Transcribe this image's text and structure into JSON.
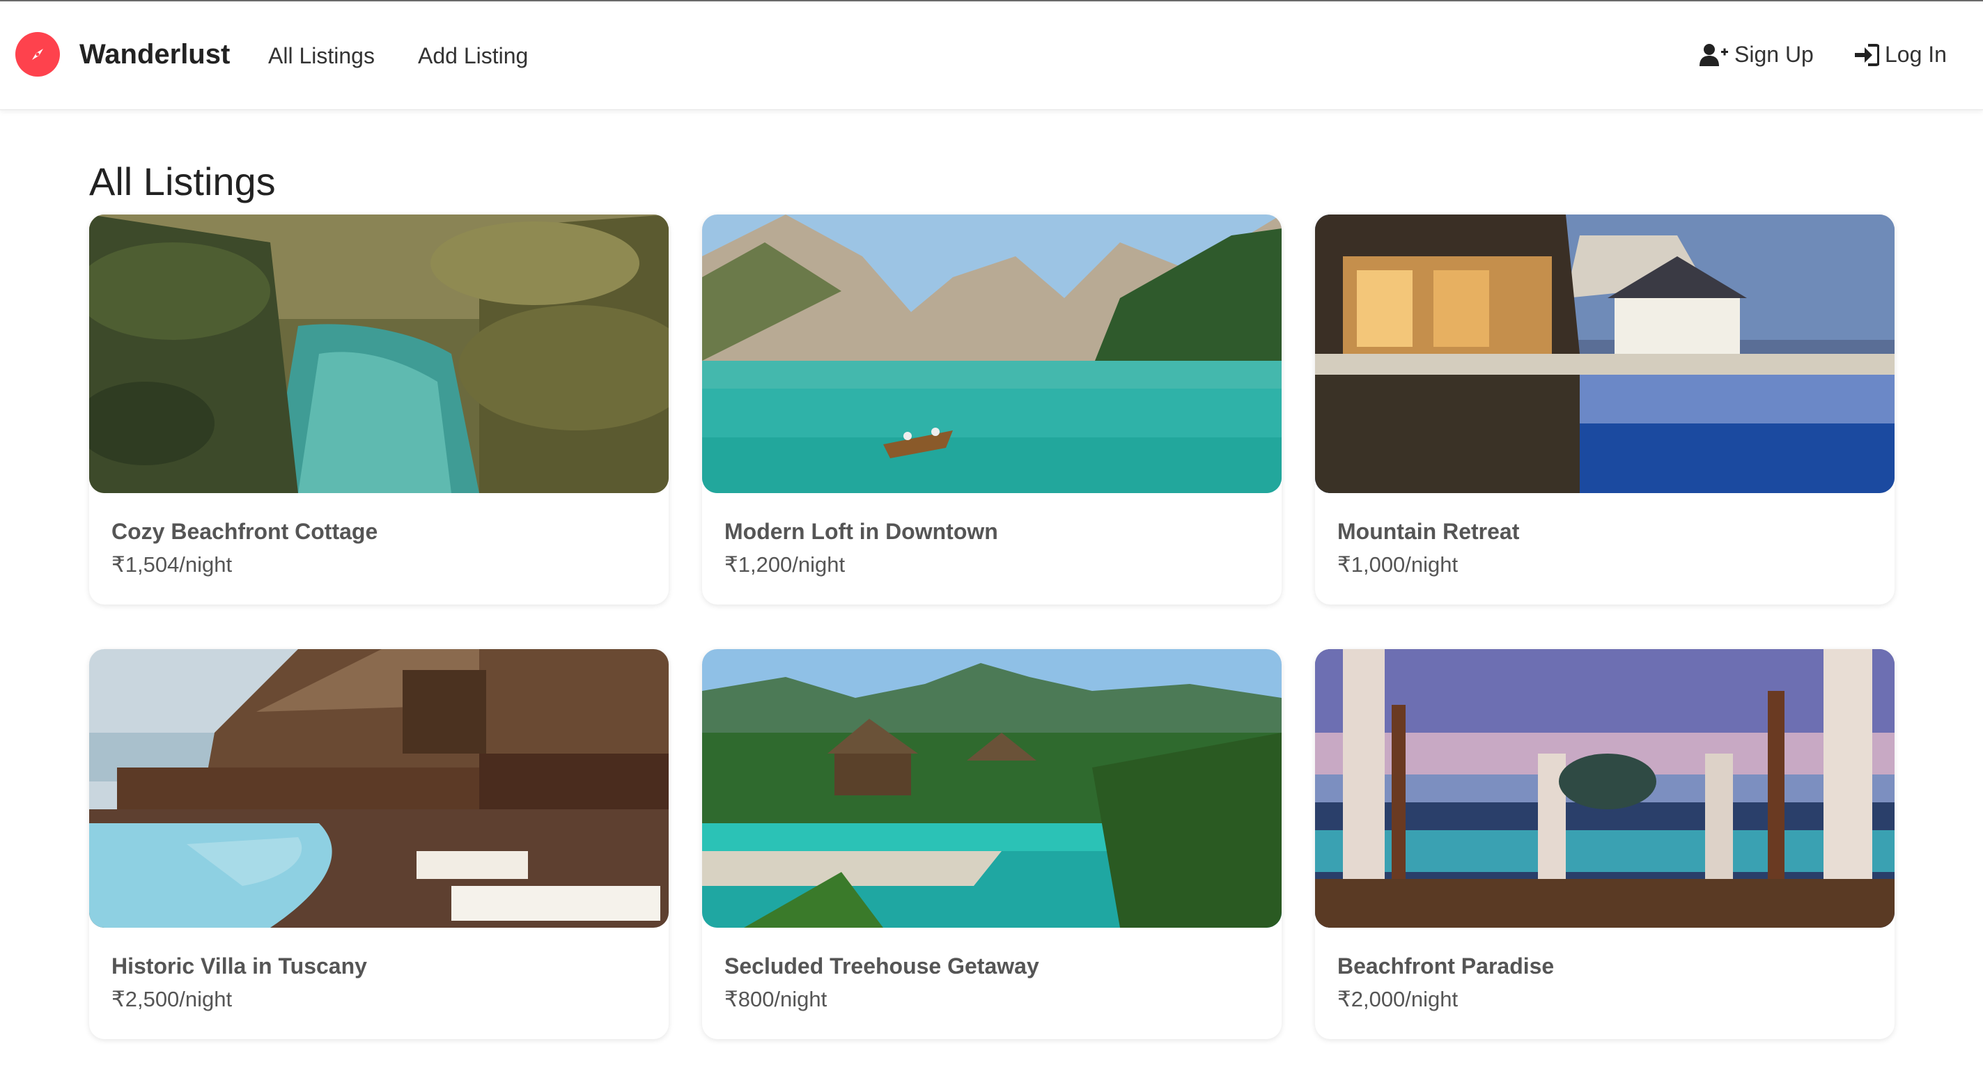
{
  "navbar": {
    "brand": {
      "name": "Wanderlust",
      "logo_icon": "compass-icon",
      "logo_color": "#fe424d"
    },
    "links": {
      "all_listings": "All Listings",
      "add_listing": "Add Listing"
    },
    "auth": {
      "signup_label": "Sign Up",
      "signup_icon": "user-plus-icon",
      "login_label": "Log In",
      "login_icon": "sign-in-icon"
    }
  },
  "main": {
    "title": "All Listings",
    "listings": [
      {
        "title": "Cozy Beachfront Cottage",
        "price": "₹1,504/night",
        "image": "palm-lagoon-image"
      },
      {
        "title": "Modern Loft in Downtown",
        "price": "₹1,200/night",
        "image": "mountain-lake-image"
      },
      {
        "title": "Mountain Retreat",
        "price": "₹1,000/night",
        "image": "resort-pool-image"
      },
      {
        "title": "Historic Villa in Tuscany",
        "price": "₹2,500/night",
        "image": "wooden-villa-pool-image"
      },
      {
        "title": "Secluded Treehouse Getaway",
        "price": "₹800/night",
        "image": "tropical-pool-huts-image"
      },
      {
        "title": "Beachfront Paradise",
        "price": "₹2,000/night",
        "image": "infinity-pool-sunset-image"
      }
    ]
  }
}
